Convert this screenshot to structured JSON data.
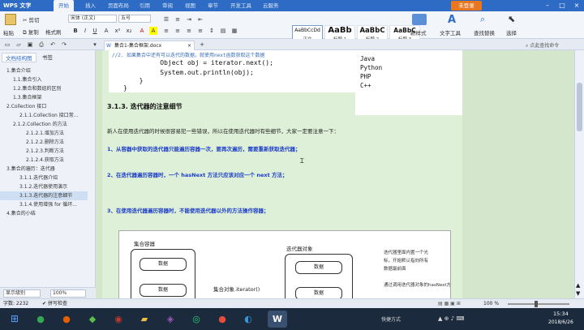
{
  "titlebar": {
    "app_name": "WPS 文字",
    "tabs": [
      "开始",
      "插入",
      "页面布局",
      "引用",
      "审阅",
      "视图",
      "章节",
      "开发工具",
      "云服务"
    ],
    "active_tab": 0,
    "login_label": "未登录"
  },
  "ribbon": {
    "paste_label": "粘贴",
    "cut_label": "剪切",
    "copy_label": "复制",
    "format_painter_label": "格式刷",
    "font_name": "宋体 (正文)",
    "font_size": "五号",
    "styles": [
      {
        "preview": "AaBbCcDd",
        "label": "正文"
      },
      {
        "preview": "AaBb",
        "label": "标题 1"
      },
      {
        "preview": "AaBbC",
        "label": "标题 2"
      },
      {
        "preview": "AaBbC",
        "label": "标题 3"
      }
    ],
    "new_style_label": "新样式",
    "text_tools_label": "文字工具",
    "find_replace_label": "查找替换",
    "select_label": "选择"
  },
  "doctabs": {
    "active_doc": "集合1-集合框架.docx",
    "search_hint": "点此查找命令"
  },
  "sidebar": {
    "tabs": [
      "文档结构图",
      "书签"
    ],
    "items": [
      {
        "label": "1.集合介绍",
        "level": 0
      },
      {
        "label": "1.1.集合引入",
        "level": 1
      },
      {
        "label": "1.2.集合和数组的区别",
        "level": 1
      },
      {
        "label": "1.3.集合框架",
        "level": 1
      },
      {
        "label": "2.Collection 接口",
        "level": 0
      },
      {
        "label": "2.1.1.Collection 接口常...",
        "level": 2
      },
      {
        "label": "2.1.2.Collection 的方法",
        "level": 1
      },
      {
        "label": "2.1.2.1.增加方法",
        "level": 3
      },
      {
        "label": "2.1.2.2.删除方法",
        "level": 3
      },
      {
        "label": "2.1.2.3.判断方法",
        "level": 3
      },
      {
        "label": "2.1.2.4.获取方法",
        "level": 3
      },
      {
        "label": "3.集合的遍历：迭代器",
        "level": 0
      },
      {
        "label": "3.1.1.迭代器介绍",
        "level": 2
      },
      {
        "label": "3.1.2.迭代器使用演示",
        "level": 2
      },
      {
        "label": "3.1.3.迭代器的注意细节",
        "level": 2
      },
      {
        "label": "3.1.4.使用增强 for 循环...",
        "level": 2
      },
      {
        "label": "4.集合的小结",
        "level": 0
      }
    ],
    "selected_index": 14,
    "footer_view": "显示级别",
    "footer_zoom": "100%"
  },
  "document": {
    "code_lines": [
      "    //2. 如果集合中还有可以迭代的数据，就使用next函数获取这个数据",
      "    Object obj = iterator.next();",
      "    System.out.println(obj);",
      "  }",
      "}"
    ],
    "output_lines": [
      "Java",
      "Python",
      "PHP",
      "C++"
    ],
    "heading": "3.1.3. 迭代器的注意细节",
    "intro": "新人在使用迭代器的时候很容易犯一些错误，所以在使用迭代器时有些细节，大家一定要注意一下：",
    "rule1": "1、从容器中获取的迭代器只能遍历容器一次，要再次遍历，需要重新获取迭代器；",
    "rule2": "2、在迭代器遍历容器时，一个 hasNext 方法只应该对应一个 next 方法；",
    "rule3": "3、在使用迭代器遍历容器时，不能使用迭代器以外的方法操作容器；",
    "diagram": {
      "container_label": "集合容器",
      "iterator_label": "迭代器对象",
      "cell_text": "数据",
      "call_text": "集合对象.iterator()"
    },
    "notes": [
      "迭代器里面内置一个光",
      "标，开始默认指向所有",
      "数据最前面",
      "通过调用迭代器对象的hasNext方法，判断迭"
    ]
  },
  "status": {
    "word_count": "字数: 2232",
    "spell_check": "拼写检查",
    "zoom": "100 %"
  },
  "taskbar": {
    "ime_label": "快捷方式",
    "time": "15:34",
    "date": "2018/6/26"
  }
}
